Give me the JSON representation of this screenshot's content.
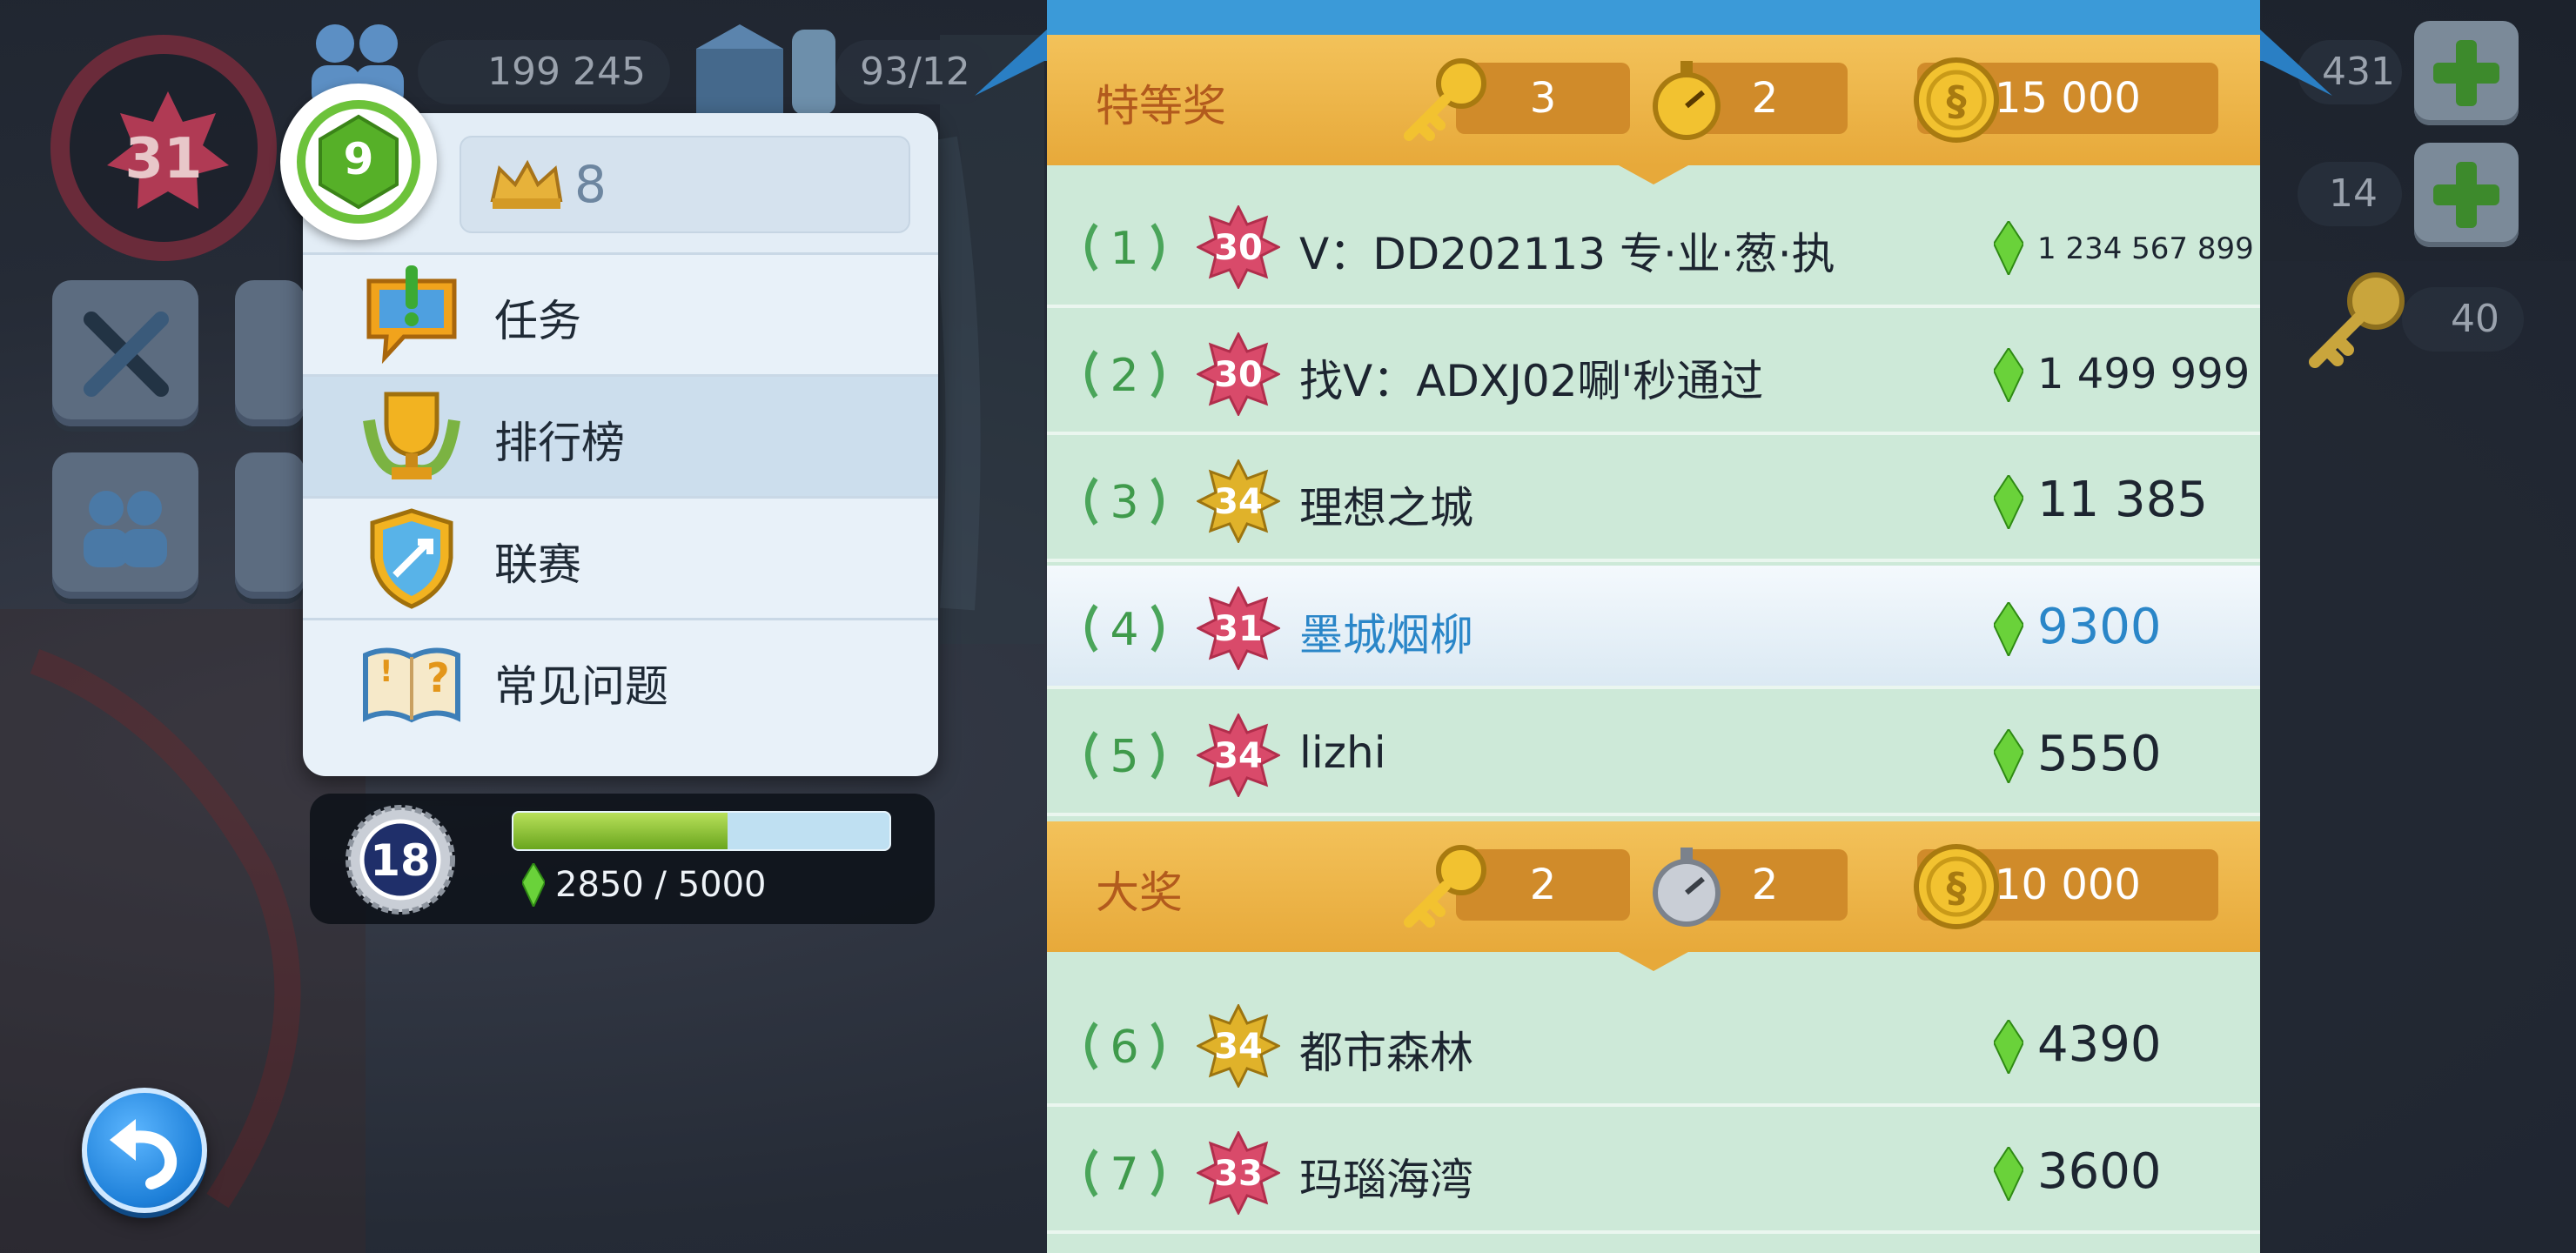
{
  "hud": {
    "city_level": "31",
    "population": "199 245",
    "storage": "93/12",
    "right_top_value": "431",
    "right_mid_value": "14",
    "keys_value": "40"
  },
  "menu": {
    "player_level": "9",
    "currency_value": "8",
    "items": [
      {
        "label": "任务"
      },
      {
        "label": "排行榜"
      },
      {
        "label": "联赛"
      },
      {
        "label": "常见问题"
      }
    ]
  },
  "xp": {
    "league_level": "18",
    "progress_text": "2850 / 5000",
    "progress": 0.57
  },
  "leaderboard": {
    "tiers": [
      {
        "name": "特等奖",
        "keys": "3",
        "speedups": "2",
        "coins": "15 000"
      },
      {
        "name": "大奖",
        "keys": "2",
        "speedups": "2",
        "coins": "10 000"
      }
    ],
    "rows": [
      {
        "rank": "1",
        "level": "30",
        "name": "V：DD202113 专·业·葱·执",
        "score": "1 234 567 899"
      },
      {
        "rank": "2",
        "level": "30",
        "name": "找V：ADXJ02唰'秒通过",
        "score": "1 499 999"
      },
      {
        "rank": "3",
        "level": "34",
        "name": "理想之城",
        "score": "11 385"
      },
      {
        "rank": "4",
        "level": "31",
        "name": "墨城烟柳",
        "score": "9300"
      },
      {
        "rank": "5",
        "level": "34",
        "name": "lizhi",
        "score": "5550"
      },
      {
        "rank": "6",
        "level": "34",
        "name": "都市森林",
        "score": "4390"
      },
      {
        "rank": "7",
        "level": "33",
        "name": "玛瑙海湾",
        "score": "3600"
      }
    ]
  },
  "colors": {
    "gold_tier": "#e7a93a",
    "row_green": "#cde9d8",
    "highlight_blue": "#2a86c8",
    "level_pink": "#d94a6a",
    "level_gold": "#e0b22a"
  }
}
